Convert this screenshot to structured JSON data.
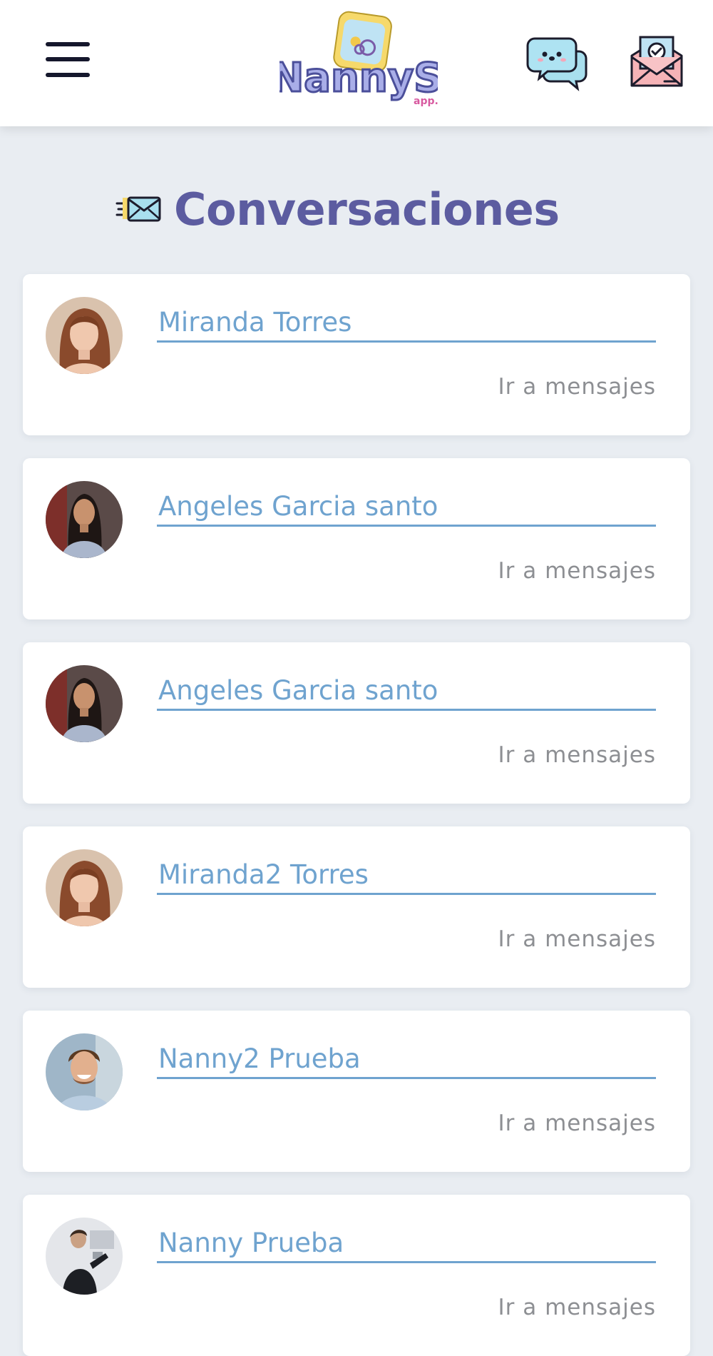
{
  "header": {
    "logo_text": "NannyS",
    "logo_subtext": "app."
  },
  "page": {
    "title": "Conversaciones"
  },
  "conversations": [
    {
      "name": "Miranda Torres",
      "link_label": "Ir a mensajes"
    },
    {
      "name": "Angeles Garcia santo",
      "link_label": "Ir a mensajes"
    },
    {
      "name": "Angeles Garcia santo",
      "link_label": "Ir a mensajes"
    },
    {
      "name": "Miranda2 Torres",
      "link_label": "Ir a mensajes"
    },
    {
      "name": "Nanny2 Prueba",
      "link_label": "Ir a mensajes"
    },
    {
      "name": "Nanny Prueba",
      "link_label": "Ir a mensajes"
    }
  ],
  "colors": {
    "background": "#e9edf2",
    "title": "#5c5ca0",
    "name_link": "#6fa3cf",
    "secondary_text": "#8d8f93"
  },
  "icons": [
    "menu-icon",
    "chat-bubble-icon",
    "mail-check-icon",
    "envelope-fast-icon"
  ]
}
